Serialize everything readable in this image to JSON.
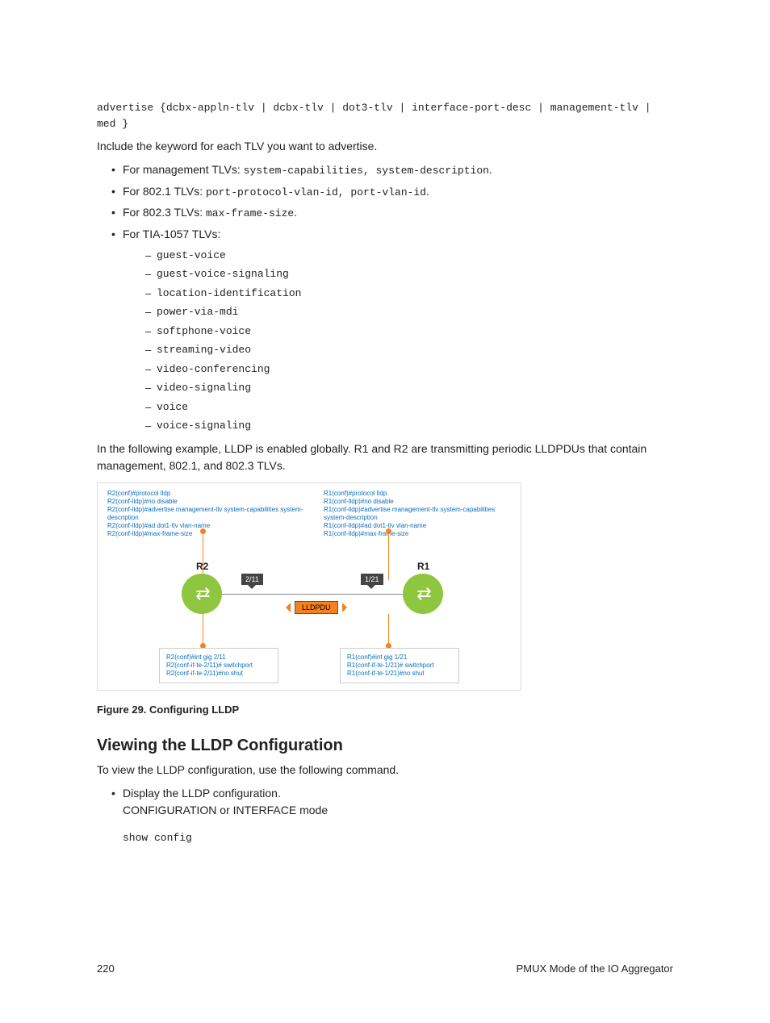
{
  "code_block": "advertise {dcbx-appln-tlv | dcbx-tlv | dot3-tlv | interface-port-desc | management-tlv | med }",
  "intro_keyword": "Include the keyword for each TLV you want to advertise.",
  "tlv_groups": [
    {
      "label": "For management TLVs:",
      "values": "system-capabilities, system-description",
      "trail": "."
    },
    {
      "label": "For 802.1 TLVs:",
      "values": "port-protocol-vlan-id, port-vlan-id",
      "trail": "."
    },
    {
      "label": "For 802.3 TLVs:",
      "values": "max-frame-size",
      "trail": "."
    },
    {
      "label": "For TIA-1057 TLVs:",
      "values": "",
      "trail": ""
    }
  ],
  "tia_items": [
    "guest-voice",
    "guest-voice-signaling",
    "location-identification",
    "power-via-mdi",
    "softphone-voice",
    "streaming-video",
    "video-conferencing",
    "video-signaling",
    "voice",
    "voice-signaling"
  ],
  "example_para": "In the following example, LLDP is enabled globally. R1 and R2 are transmitting periodic LLDPDUs that contain management, 802.1, and 802.3 TLVs.",
  "diagram": {
    "r2": {
      "name": "R2",
      "port": "2/11",
      "top_cfg": [
        "R2(conf)#protocol lldp",
        "R2(conf-lldp)#no disable",
        "R2(conf-lldp)#advertise management-tlv system-capabilities system-description",
        "R2(conf-lldp)#ad dot1-tlv vlan-name",
        "R2(conf-lldp)#max-frame-size"
      ],
      "bottom_cfg": [
        "R2(conf)#int gig 2/11",
        "R2(conf-if-te-2/11)# switchport",
        "R2(conf-if-te-2/11)#no shut"
      ]
    },
    "r1": {
      "name": "R1",
      "port": "1/21",
      "top_cfg": [
        "R1(conf)#protocol lldp",
        "R1(conf-lldp)#no disable",
        "R1(conf-lldp)#advertise management-tlv system-capabilities system-description",
        "R1(conf-lldp)#ad dot1-tlv vlan-name",
        "R1(conf-lldp)#max-frame-size"
      ],
      "bottom_cfg": [
        "R1(conf)#int gig 1/21",
        "R1(conf-if-te-1/21)# switchport",
        "R1(conf-if-te-1/21)#no shut"
      ]
    },
    "packet": "LLDPDU"
  },
  "figure_caption": "Figure 29. Configuring LLDP",
  "section_heading": "Viewing the LLDP Configuration",
  "view_intro": "To view the LLDP configuration, use the following command.",
  "view_bullet_line1": "Display the LLDP configuration.",
  "view_bullet_line2": "CONFIGURATION or INTERFACE mode",
  "show_cmd": "show config",
  "footer": {
    "page": "220",
    "title": "PMUX Mode of the IO Aggregator"
  }
}
